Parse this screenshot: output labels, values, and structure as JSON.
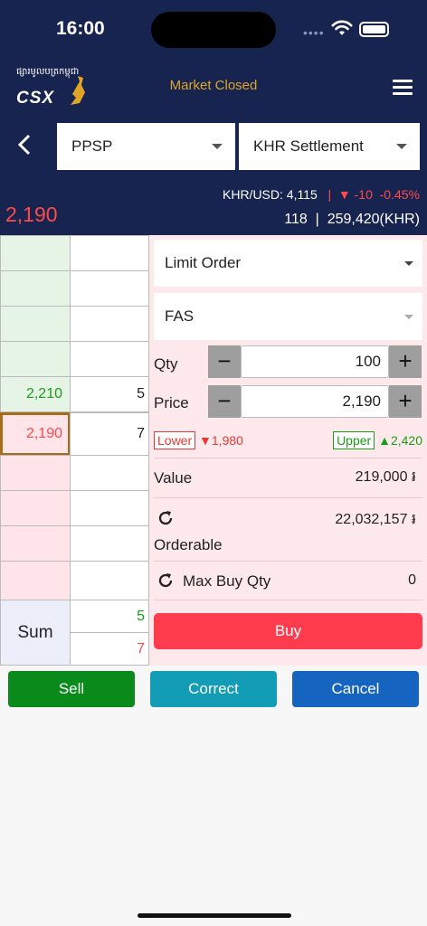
{
  "status": {
    "time": "16:00",
    "dots": "••••"
  },
  "header": {
    "logo_khmer": "ផ្សារមូលបត្រកម្ពុជា",
    "logo_text": "CSX",
    "market_status": "Market Closed",
    "market_color": "#e0a526"
  },
  "selectors": {
    "symbol": "PPSP",
    "settlement": "KHR Settlement"
  },
  "info": {
    "last_price": "2,190",
    "fx_label": "KHR/USD: 4,115",
    "separator": "|",
    "change": "-10",
    "change_pct": "-0.45%",
    "volume": "118",
    "value": "259,420(KHR)"
  },
  "orderbook": {
    "rows": [
      {
        "price": "",
        "qty": ""
      },
      {
        "price": "",
        "qty": ""
      },
      {
        "price": "",
        "qty": ""
      },
      {
        "price": "",
        "qty": ""
      },
      {
        "price": "2,210",
        "qty": "5"
      },
      {
        "price": "2,190",
        "qty": "7"
      },
      {
        "price": "",
        "qty": ""
      },
      {
        "price": "",
        "qty": ""
      },
      {
        "price": "",
        "qty": ""
      },
      {
        "price": "",
        "qty": ""
      }
    ],
    "sum_label": "Sum",
    "sum_sell": "5",
    "sum_buy": "7"
  },
  "form": {
    "order_type": "Limit Order",
    "account": "FAS",
    "qty_label": "Qty",
    "qty_value": "100",
    "price_label": "Price",
    "price_value": "2,190",
    "minus": "−",
    "plus": "+",
    "lower_label": "Lower",
    "lower_value": "1,980",
    "upper_label": "Upper",
    "upper_value": "2,420",
    "value_label": "Value",
    "value_amount": "219,000 ៛",
    "orderable_label": "Orderable",
    "orderable_amount": "22,032,157 ៛",
    "maxbuy_label": "Max Buy Qty",
    "maxbuy_value": "0",
    "buy_label": "Buy"
  },
  "actions": {
    "sell": "Sell",
    "correct": "Correct",
    "cancel": "Cancel"
  },
  "colors": {
    "navy": "#17244f",
    "up": "#1a9c1a",
    "down": "#ff4a4a",
    "buy": "#ff3b4e",
    "sell": "#0a8a1a",
    "correct": "#129cb5",
    "cancel": "#1564c0"
  }
}
